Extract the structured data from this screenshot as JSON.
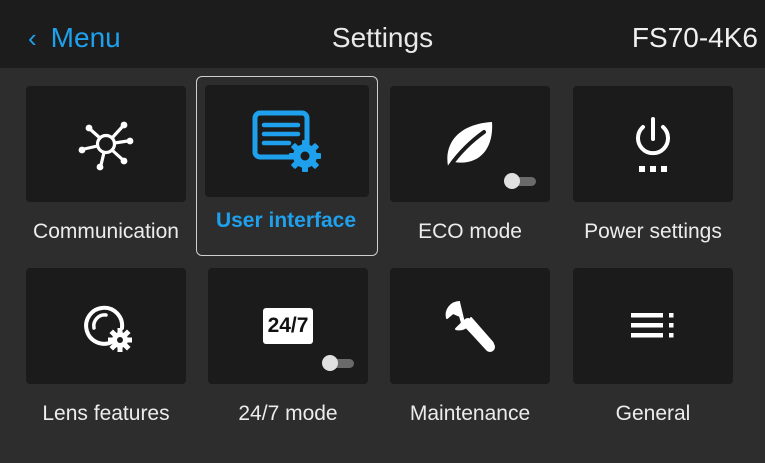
{
  "header": {
    "back_label": "Menu",
    "title": "Settings",
    "model": "FS70-4K6"
  },
  "tiles": [
    {
      "label": "Communication",
      "icon": "network-hub-icon",
      "selected": false
    },
    {
      "label": "User interface",
      "icon": "document-gear-icon",
      "selected": true
    },
    {
      "label": "ECO mode",
      "icon": "leaf-icon",
      "toggle": "off"
    },
    {
      "label": "Power settings",
      "icon": "power-icon"
    },
    {
      "label": "Lens features",
      "icon": "lens-gear-icon"
    },
    {
      "label": "24/7 mode",
      "icon": "24-7-badge-icon",
      "badge_text": "24/7",
      "toggle": "off"
    },
    {
      "label": "Maintenance",
      "icon": "wrench-icon"
    },
    {
      "label": "General",
      "icon": "list-icon"
    }
  ],
  "colors": {
    "accent": "#1ea0ec",
    "header_bg": "#1c1c1c",
    "tile_bg": "#1b1b1b",
    "page_bg": "#2d2d2d"
  }
}
